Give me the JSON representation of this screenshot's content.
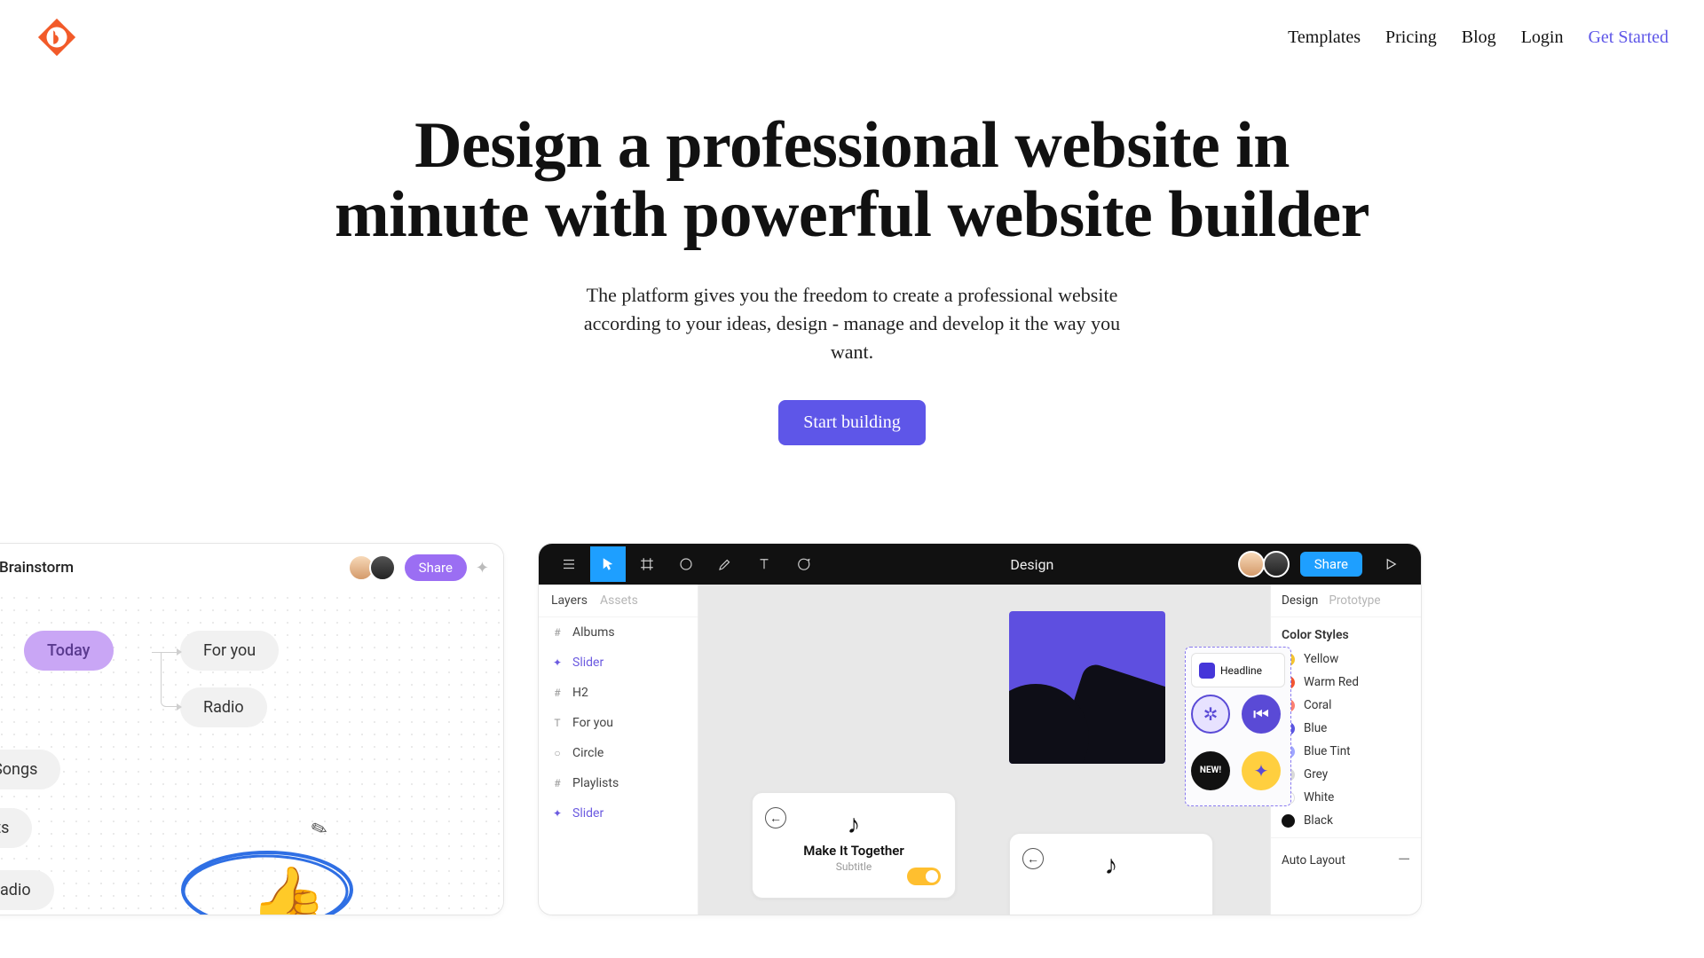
{
  "nav": {
    "templates": "Templates",
    "pricing": "Pricing",
    "blog": "Blog",
    "login": "Login",
    "get_started": "Get Started"
  },
  "hero": {
    "headline": "Design a professional website in minute with powerful website builder",
    "sub": "The platform gives you the freedom to create a professional website according to your ideas, design - manage and develop it the way you want.",
    "cta": "Start building"
  },
  "brainstorm": {
    "title": "Brainstorm",
    "share": "Share",
    "chips": {
      "today": "Today",
      "foryou": "For you",
      "radio": "Radio",
      "liked": "ked Songs",
      "playlists": "aylists",
      "artist": "tist Radio"
    }
  },
  "design": {
    "title": "Design",
    "share": "Share",
    "tabs": {
      "layers": "Layers",
      "assets": "Assets",
      "design": "Design",
      "prototype": "Prototype"
    },
    "layers": {
      "albums": "Albums",
      "slider1": "Slider",
      "h2": "H2",
      "foryou": "For you",
      "circle": "Circle",
      "playlists": "Playlists",
      "slider2": "Slider"
    },
    "headline_chip": "Headline",
    "new_badge": "NEW!",
    "tile": {
      "title": "Make It Together",
      "sub": "Subtitle"
    },
    "color_styles_header": "Color Styles",
    "colors": [
      {
        "name": "Yellow",
        "hex": "#f4c430"
      },
      {
        "name": "Warm Red",
        "hex": "#f25532"
      },
      {
        "name": "Coral",
        "hex": "#fb8072"
      },
      {
        "name": "Blue",
        "hex": "#5a56e0"
      },
      {
        "name": "Blue Tint",
        "hex": "#9fa6ff"
      },
      {
        "name": "Grey",
        "hex": "#d9d9d9"
      },
      {
        "name": "White",
        "hex": "#ffffff"
      },
      {
        "name": "Black",
        "hex": "#111111"
      }
    ],
    "auto_layout": "Auto Layout"
  },
  "accent": "#5E56E8"
}
